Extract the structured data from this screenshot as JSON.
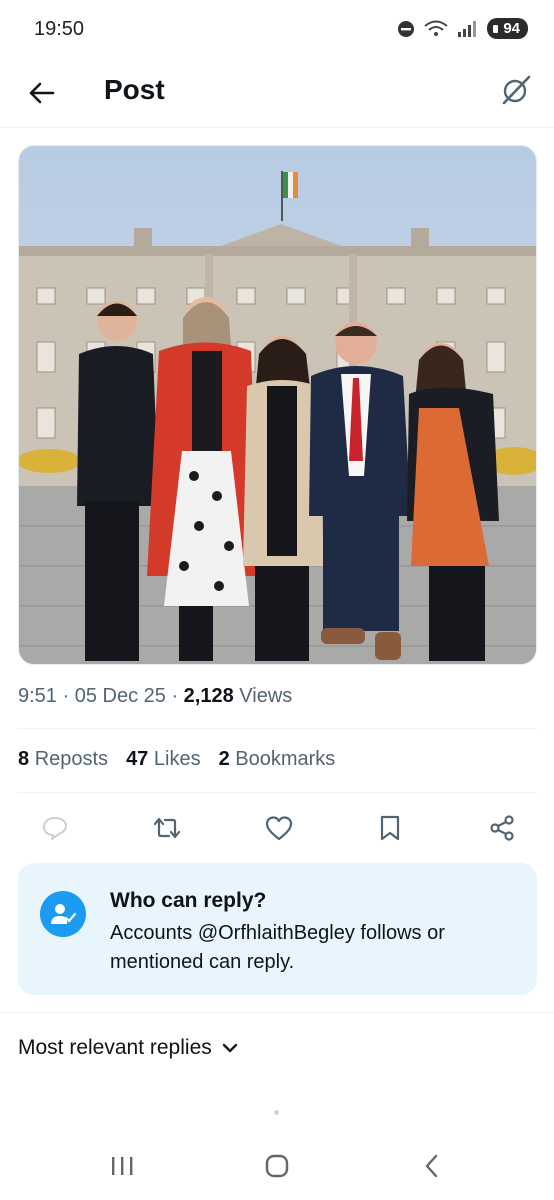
{
  "status": {
    "time": "19:50",
    "battery": "94"
  },
  "header": {
    "title": "Post"
  },
  "post": {
    "time": "9:51",
    "date": "05 Dec 25",
    "views_count": "2,128",
    "views_label": "Views"
  },
  "stats": [
    {
      "count": "8",
      "label": "Reposts"
    },
    {
      "count": "47",
      "label": "Likes"
    },
    {
      "count": "2",
      "label": "Bookmarks"
    }
  ],
  "reply_settings": {
    "title": "Who can reply?",
    "body": "Accounts @OrfhlaithBegley follows or mentioned can reply."
  },
  "sort": {
    "label": "Most relevant replies"
  },
  "icons": {
    "back": "arrow-left-icon",
    "grok": "grok-icon",
    "reply": "comment-icon",
    "repost": "repost-icon",
    "like": "heart-icon",
    "bookmark": "bookmark-icon",
    "share": "share-icon"
  },
  "colors": {
    "accent": "#1d9bf0",
    "text": "#0f1419",
    "muted": "#536471",
    "card": "#e8f5fd"
  }
}
